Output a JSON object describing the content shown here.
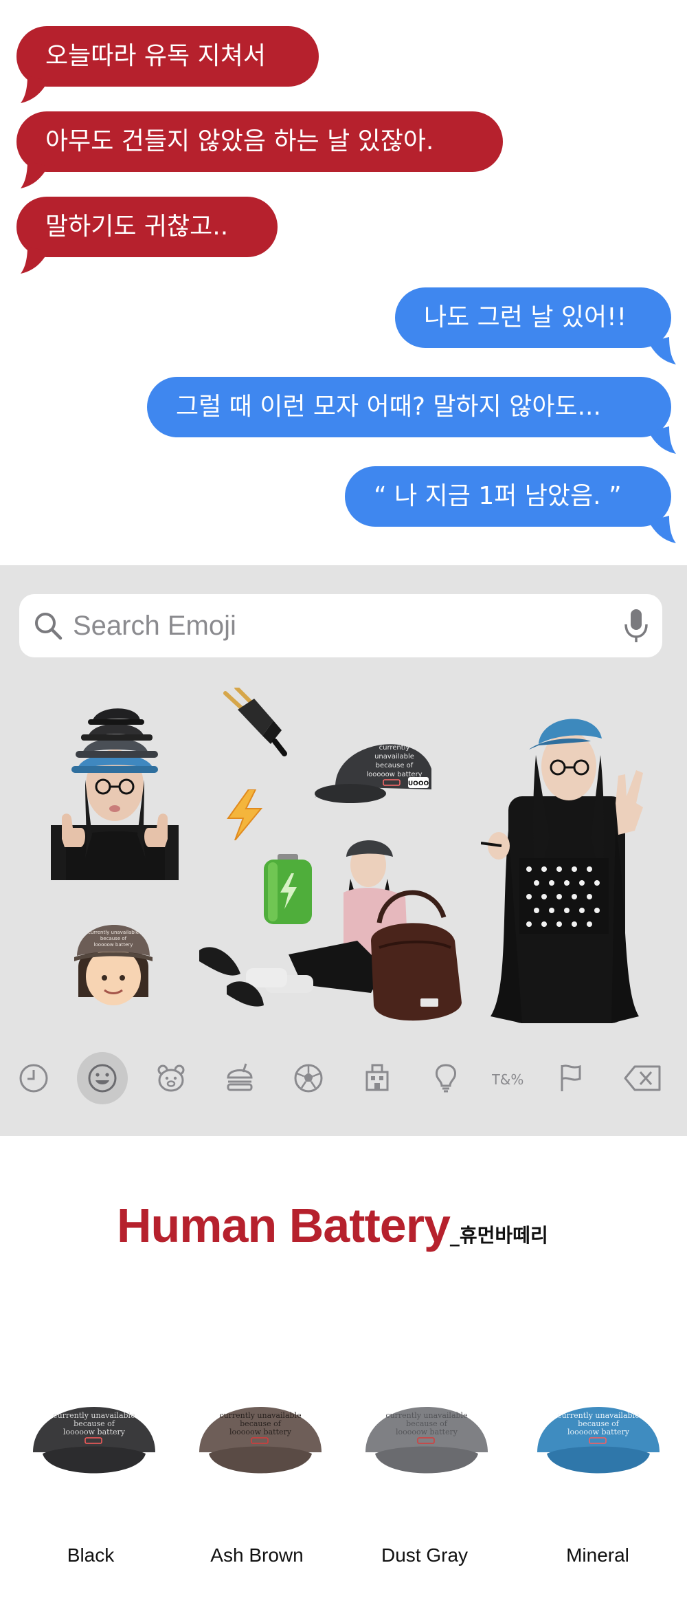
{
  "chat": {
    "incoming": [
      "오늘따라 유독 지쳐서",
      "아무도 건들지 않았음 하는 날 있잖아.",
      "말하기도 귀찮고.."
    ],
    "outgoing": [
      "나도 그런 날 있어!!",
      "그럴 때 이런 모자 어때? 말하지 않아도...",
      "“ 나 지금 1퍼 남았음. ”"
    ],
    "colors": {
      "incoming": "#b6212d",
      "outgoing": "#3f87ef"
    }
  },
  "keyboard": {
    "search_placeholder": "Search Emoji",
    "search_icon": "magnifier-icon",
    "mic_icon": "microphone-icon",
    "stickers": {
      "cap_text": [
        "currently",
        "unavailable",
        "because of",
        "looooow battery"
      ],
      "cap_brand": "UOOO",
      "small_cap_text": [
        "currently unavailable",
        "because of",
        "looooow battery"
      ]
    },
    "categories": [
      {
        "icon": "recent-clock-icon",
        "active": false
      },
      {
        "icon": "smiley-icon",
        "active": true
      },
      {
        "icon": "animal-bear-icon",
        "active": false
      },
      {
        "icon": "food-burger-icon",
        "active": false
      },
      {
        "icon": "soccer-ball-icon",
        "active": false
      },
      {
        "icon": "travel-building-icon",
        "active": false
      },
      {
        "icon": "objects-lightbulb-icon",
        "active": false
      },
      {
        "icon": "symbols-icon",
        "active": false
      },
      {
        "icon": "flag-icon",
        "active": false
      },
      {
        "icon": "backspace-icon",
        "active": false
      }
    ],
    "symbols_glyph": "T&%"
  },
  "brand": {
    "title": "Human Battery",
    "subtitle": "_휴먼바떼리",
    "accent": "#b6212d",
    "cap_print": [
      "currently unavailable",
      "because of",
      "looooow battery"
    ],
    "colors": [
      {
        "name": "Black",
        "swatch": "#3a3a3c"
      },
      {
        "name": "Ash Brown",
        "swatch": "#6e5e58"
      },
      {
        "name": "Dust Gray",
        "swatch": "#7f8084"
      },
      {
        "name": "Mineral",
        "swatch": "#3f8cc0"
      }
    ]
  }
}
